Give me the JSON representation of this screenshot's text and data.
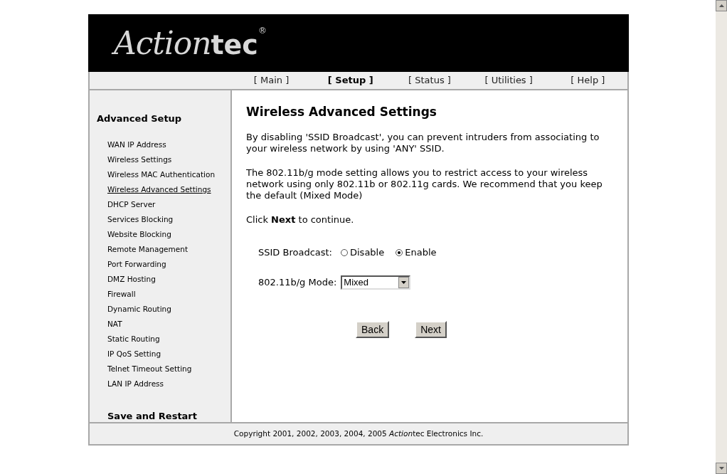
{
  "logo": {
    "script": "Action",
    "bold": "tec",
    "mark": "®"
  },
  "nav": [
    {
      "label": "[ Main ]",
      "selected": false
    },
    {
      "label": "[ Setup ]",
      "selected": true
    },
    {
      "label": "[ Status ]",
      "selected": false
    },
    {
      "label": "[ Utilities ]",
      "selected": false
    },
    {
      "label": "[ Help ]",
      "selected": false
    }
  ],
  "sidebar": {
    "heading": "Advanced Setup",
    "items": [
      {
        "label": "WAN IP Address",
        "selected": false
      },
      {
        "label": "Wireless Settings",
        "selected": false
      },
      {
        "label": "Wireless MAC Authentication",
        "selected": false
      },
      {
        "label": "Wireless Advanced Settings",
        "selected": true
      },
      {
        "label": "DHCP Server",
        "selected": false
      },
      {
        "label": "Services Blocking",
        "selected": false
      },
      {
        "label": "Website Blocking",
        "selected": false
      },
      {
        "label": "Remote Management",
        "selected": false
      },
      {
        "label": "Port Forwarding",
        "selected": false
      },
      {
        "label": "DMZ Hosting",
        "selected": false
      },
      {
        "label": "Firewall",
        "selected": false
      },
      {
        "label": "Dynamic Routing",
        "selected": false
      },
      {
        "label": "NAT",
        "selected": false
      },
      {
        "label": "Static Routing",
        "selected": false
      },
      {
        "label": "IP QoS Setting",
        "selected": false
      },
      {
        "label": "Telnet Timeout Setting",
        "selected": false
      },
      {
        "label": "LAN IP Address",
        "selected": false
      }
    ],
    "footer_link": "Save and Restart"
  },
  "content": {
    "title": "Wireless Advanced Settings",
    "paragraphs": [
      "By disabling 'SSID Broadcast', you can prevent intruders from associating to your wireless network by using 'ANY' SSID.",
      "The 802.11b/g mode setting allows you to restrict access to your wireless network using only 802.11b or 802.11g cards. We recommend that you keep the default (Mixed Mode)",
      "Click **Next** to continue."
    ],
    "ssid": {
      "label": "SSID Broadcast:",
      "options": [
        {
          "label": "Disable",
          "selected": false
        },
        {
          "label": "Enable",
          "selected": true
        }
      ]
    },
    "mode": {
      "label": "802.11b/g Mode:",
      "value": "Mixed"
    },
    "buttons": [
      "Back",
      "Next"
    ]
  },
  "footer": {
    "before": "Copyright 2001, 2002, 2003, 2004, 2005 ",
    "italic": "Action",
    "after": "tec Electronics Inc."
  }
}
